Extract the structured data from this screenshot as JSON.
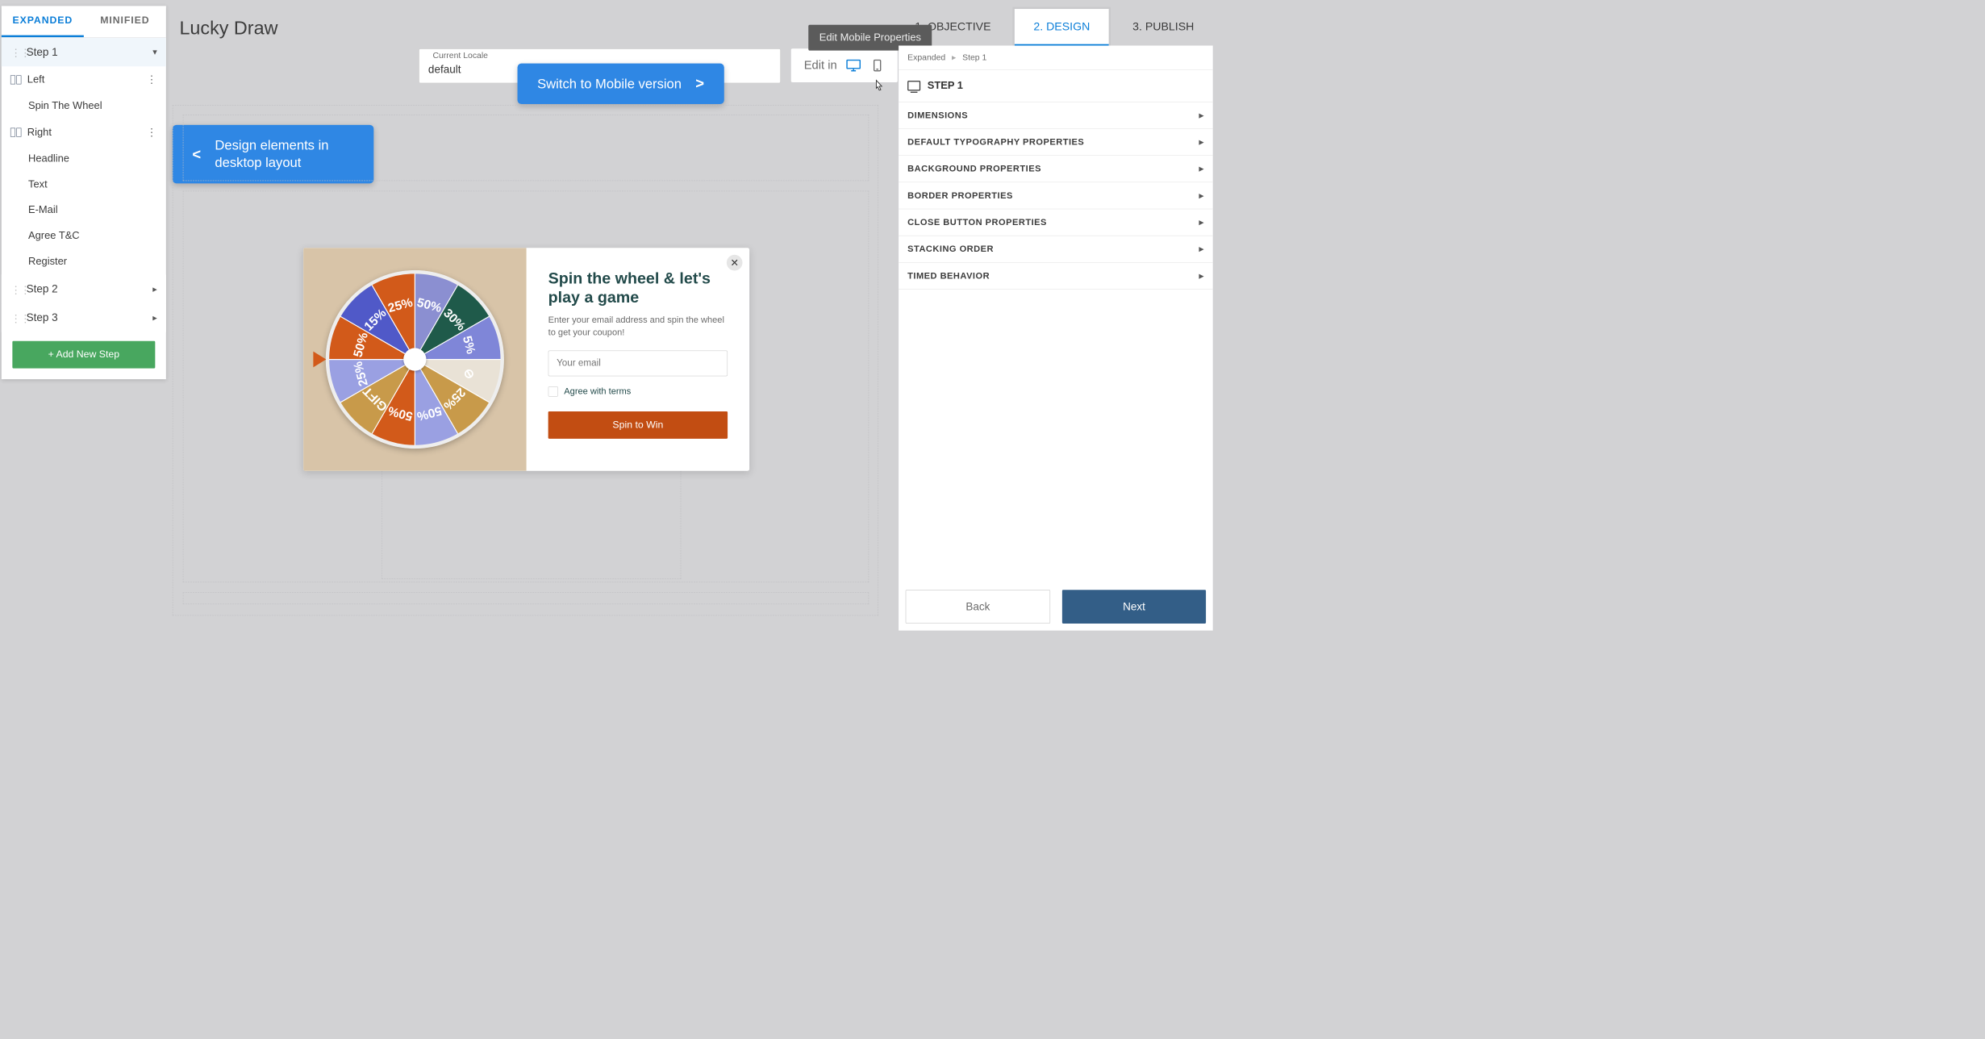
{
  "leftSidebar": {
    "tabs": {
      "expanded": "EXPANDED",
      "minified": "MINIFIED"
    },
    "steps": {
      "step1": {
        "label": "Step 1",
        "sections": {
          "left": {
            "label": "Left",
            "children": {
              "spin": "Spin The Wheel"
            }
          },
          "right": {
            "label": "Right",
            "children": {
              "headline": "Headline",
              "text": "Text",
              "email": "E-Mail",
              "agree": "Agree T&C",
              "register": "Register"
            }
          }
        }
      },
      "step2": "Step 2",
      "step3": "Step 3"
    },
    "addStep": "+ Add New Step"
  },
  "pageTitle": "Lucky Draw",
  "locale": {
    "label": "Current Locale",
    "value": "default"
  },
  "editIn": {
    "label": "Edit in"
  },
  "tooltip": "Edit Mobile Properties",
  "callouts": {
    "mobile": "Switch to Mobile version",
    "desktop": "Design elements in desktop layout"
  },
  "topSteps": {
    "s1": "1. OBJECTIVE",
    "s2": "2. DESIGN",
    "s3": "3. PUBLISH"
  },
  "popup": {
    "headline": "Spin the wheel & let's play a game",
    "sub": "Enter your email address and spin the wheel to get your coupon!",
    "placeholder": "Your email",
    "agree": "Agree with terms",
    "btn": "Spin to Win",
    "wheelSegments": [
      "50%",
      "30%",
      "5%",
      "⊘",
      "25%",
      "50%",
      "50%",
      "GIFT",
      "25%",
      "50%",
      "15%",
      "25%"
    ],
    "wheelColors": [
      "#8b8fd1",
      "#1f5a4a",
      "#7f86d8",
      "#e9e2d6",
      "#c89a4a",
      "#9aa0e2",
      "#d25a1a",
      "#c89a4a",
      "#9aa0e2",
      "#d25a1a",
      "#5059c8",
      "#d25a1a"
    ]
  },
  "rightPanel": {
    "breadcrumb": {
      "a": "Expanded",
      "b": "Step 1"
    },
    "stepLabel": "STEP 1",
    "rows": {
      "dim": "DIMENSIONS",
      "typo": "DEFAULT TYPOGRAPHY PROPERTIES",
      "bg": "BACKGROUND PROPERTIES",
      "border": "BORDER PROPERTIES",
      "close": "CLOSE BUTTON PROPERTIES",
      "stack": "STACKING ORDER",
      "timed": "TIMED BEHAVIOR"
    },
    "back": "Back",
    "next": "Next"
  }
}
